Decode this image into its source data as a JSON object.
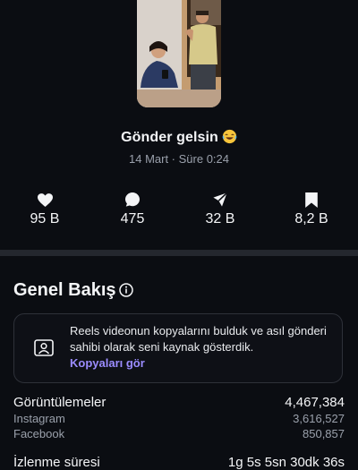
{
  "post": {
    "caption": "Gönder gelsin",
    "caption_emoji": "😂",
    "meta": "14 Mart · Süre 0:24"
  },
  "stats": [
    {
      "icon": "heart-icon",
      "value": "95 B"
    },
    {
      "icon": "comment-icon",
      "value": "475"
    },
    {
      "icon": "share-icon",
      "value": "32 B"
    },
    {
      "icon": "bookmark-icon",
      "value": "8,2 B"
    }
  ],
  "overview": {
    "title": "Genel Bakış",
    "info_icon": "info-icon",
    "card": {
      "icon": "original-creator-icon",
      "text": "Reels videonun kopyalarını bulduk ve asıl gönderi sahibi olarak seni kaynak gösterdik.",
      "link": "Kopyaları gör"
    }
  },
  "metrics": {
    "views": {
      "label": "Görüntülemeler",
      "value": "4,467,384"
    },
    "instagram": {
      "label": "Instagram",
      "value": "3,616,527"
    },
    "facebook": {
      "label": "Facebook",
      "value": "850,857"
    },
    "next": {
      "label": "İzlenme süresi",
      "value": "1g 5s 5sn 30dk 36s"
    }
  },
  "colors": {
    "background": "#0b0d12",
    "divider": "#24272e",
    "link": "#9b8cff",
    "muted_text": "#9aa0ab"
  }
}
